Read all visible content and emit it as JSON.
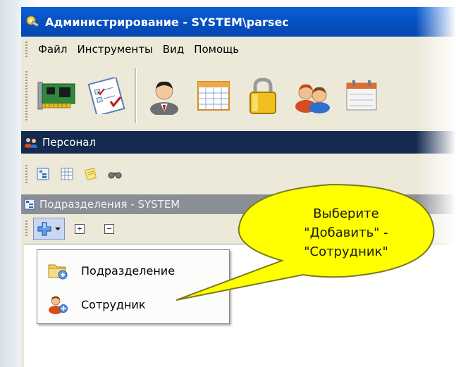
{
  "window": {
    "title": "Администрирование - SYSTEM\\parsec"
  },
  "menu": {
    "items": [
      "Файл",
      "Инструменты",
      "Вид",
      "Помощь"
    ]
  },
  "toolbar": {
    "icons": [
      "network-card-icon",
      "checklist-icon",
      "user-icon",
      "calendar-grid-icon",
      "lock-icon",
      "users-group-icon",
      "schedule-icon"
    ]
  },
  "panel": {
    "title": "Персонал"
  },
  "pane": {
    "title": "Подразделения - SYSTEM",
    "buttons": {
      "expand": "+",
      "collapse": "−"
    }
  },
  "dropdown": {
    "items": [
      {
        "label": "Подразделение",
        "icon": "folder-add-icon"
      },
      {
        "label": "Сотрудник",
        "icon": "user-add-icon"
      }
    ]
  },
  "callout": {
    "line1": "Выберите",
    "line2": "\"Добавить\" -",
    "line3": "\"Сотрудник\"",
    "fill": "#ffff00"
  }
}
